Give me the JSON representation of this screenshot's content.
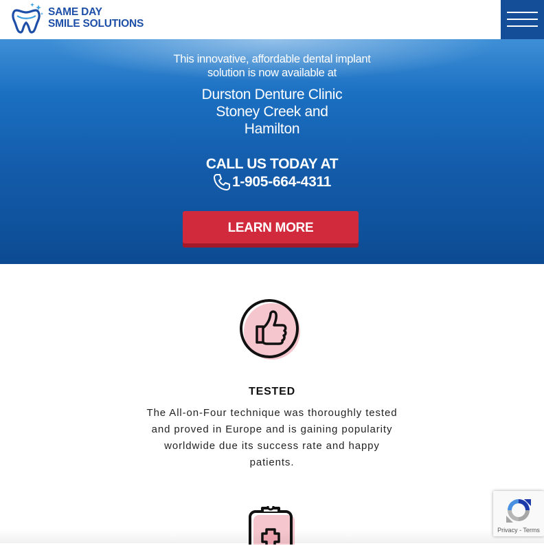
{
  "header": {
    "logo_line1": "SAME DAY",
    "logo_line2": "SMILE SOLUTIONS",
    "menu_icon": "hamburger-menu-icon"
  },
  "hero": {
    "intro_line1": "This innovative, affordable dental implant",
    "intro_line2": "solution is now available at",
    "clinic_line1": "Durston Denture Clinic",
    "clinic_line2": "Stoney Creek and",
    "clinic_line3": "Hamilton",
    "call_label": "CALL US TODAY AT",
    "phone_icon": "phone-icon",
    "phone": "1-905-664-4311",
    "learn_more": "LEARN MORE"
  },
  "feature": {
    "icon": "thumbs-up-icon",
    "title": "TESTED",
    "desc_line1": "The All-on-Four technique was thoroughly tested",
    "desc_line2": "and proved in Europe and is gaining popularity",
    "desc_line3": "worldwide due its success rate and happy",
    "desc_line4": "patients."
  },
  "next_feature": {
    "icon": "medical-clipboard-icon"
  },
  "recaptcha": {
    "privacy": "Privacy",
    "separator": " - ",
    "terms": "Terms"
  },
  "colors": {
    "brand_blue": "#1e4fa8",
    "menu_blue": "#154e98",
    "button_red": "#d22a3d",
    "icon_pink": "#f2a7b4"
  }
}
